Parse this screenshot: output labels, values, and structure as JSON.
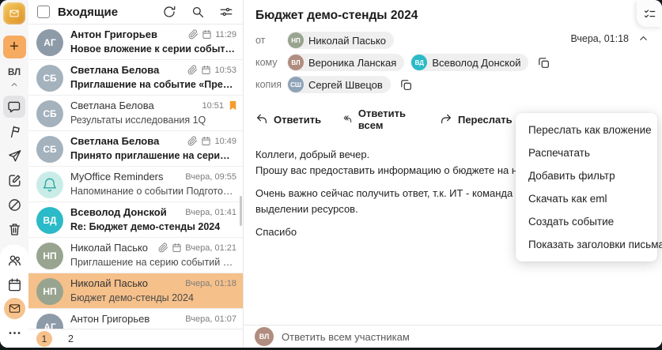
{
  "colors": {
    "accent_orange": "#f6ab61",
    "selected_row": "#f6c08a",
    "teal_avatar": "#2bbac7",
    "flag_orange": "#F59C2E"
  },
  "rail": {
    "initials": "ВЛ"
  },
  "list": {
    "title": "Входящие",
    "pages": {
      "current": "1",
      "next": "2"
    },
    "messages": [
      {
        "sender": "Антон Григорьев",
        "subject": "Новое вложение к серии событий «Аналити...",
        "time": "11:29",
        "unread": true,
        "selected": false,
        "attach": true,
        "calendar": true,
        "flag": false,
        "avatar": {
          "initials": "АГ",
          "color": "#8d9aa8"
        }
      },
      {
        "sender": "Светлана Белова",
        "subject": "Приглашение на событие «Предварительно...",
        "time": "10:53",
        "unread": true,
        "selected": false,
        "attach": true,
        "calendar": true,
        "flag": false,
        "avatar": {
          "initials": "СБ",
          "color": "#a3b2bd"
        }
      },
      {
        "sender": "Светлана Белова",
        "subject": "Результаты исследования 1Q",
        "time": "10:51",
        "unread": false,
        "selected": false,
        "attach": false,
        "calendar": false,
        "flag": true,
        "avatar": {
          "initials": "СБ",
          "color": "#a3b2bd"
        }
      },
      {
        "sender": "Светлана Белова",
        "subject": "Принято приглашение на серию событий «...",
        "time": "10:49",
        "unread": true,
        "selected": false,
        "attach": true,
        "calendar": true,
        "flag": false,
        "avatar": {
          "initials": "СБ",
          "color": "#a3b2bd"
        }
      },
      {
        "sender": "MyOffice Reminders",
        "subject": "Напоминание о событии Подготовить отчет...",
        "time": "Вчера, 09:55",
        "unread": false,
        "selected": false,
        "attach": false,
        "calendar": false,
        "flag": false,
        "avatar": {
          "bell": true,
          "color": "#c9ece9",
          "icon_color": "#2aa8a0"
        }
      },
      {
        "sender": "Всеволод Донской",
        "subject": "Re: Бюджет демо-стенды 2024",
        "time": "Вчера, 01:41",
        "unread": true,
        "selected": false,
        "attach": false,
        "calendar": false,
        "flag": false,
        "avatar": {
          "initials": "ВД",
          "color": "#2bbac7"
        }
      },
      {
        "sender": "Николай Пасько",
        "subject": "Приглашение на серию событий «Демо стен...",
        "time": "Вчера, 01:21",
        "unread": false,
        "selected": false,
        "attach": true,
        "calendar": true,
        "flag": false,
        "avatar": {
          "initials": "НП",
          "color": "#98a48f"
        }
      },
      {
        "sender": "Николай Пасько",
        "subject": "Бюджет демо-стенды 2024",
        "time": "Вчера, 01:18",
        "unread": false,
        "selected": true,
        "attach": false,
        "calendar": false,
        "flag": false,
        "avatar": {
          "initials": "НП",
          "color": "#98a48f"
        }
      },
      {
        "sender": "Антон Григорьев",
        "subject": "",
        "time": "Вчера, 01:07",
        "unread": false,
        "selected": false,
        "attach": false,
        "calendar": false,
        "flag": false,
        "avatar": {
          "initials": "АГ",
          "color": "#8d9aa8"
        }
      }
    ]
  },
  "reader": {
    "subject": "Бюджет демо-стенды 2024",
    "date": "Вчера, 01:18",
    "labels": {
      "from": "от",
      "to": "кому",
      "cc": "копия"
    },
    "from": [
      {
        "name": "Николай Пасько",
        "initials": "НП",
        "color": "#98a48f"
      }
    ],
    "to": [
      {
        "name": "Вероника Ланская",
        "initials": "ВЛ",
        "color": "#b08d80"
      },
      {
        "name": "Всеволод Донской",
        "initials": "ВД",
        "color": "#2bbac7"
      }
    ],
    "cc": [
      {
        "name": "Сергей Швецов",
        "initials": "СШ",
        "color": "#8fa3b8"
      }
    ],
    "toolbar": {
      "reply": "Ответить",
      "reply_all": "Ответить всем",
      "forward": "Переслать"
    },
    "body_lines": [
      "Коллеги, добрый вечер.",
      "Прошу вас предоставить информацию о бюджете на наши демонстраци",
      "",
      "Очень важно сейчас получить ответ, т.к. ИТ - команда Всеволода, уже",
      "выделении ресурсов.",
      "",
      "Спасибо"
    ],
    "quick_reply": {
      "label": "Ответить всем участникам",
      "avatar": {
        "initials": "ВЛ",
        "color": "#b08d80"
      }
    }
  },
  "context_menu": {
    "items": [
      "Переслать как вложение",
      "Распечатать",
      "Добавить фильтр",
      "Скачать как eml",
      "Создать событие",
      "Показать заголовки письма"
    ]
  }
}
